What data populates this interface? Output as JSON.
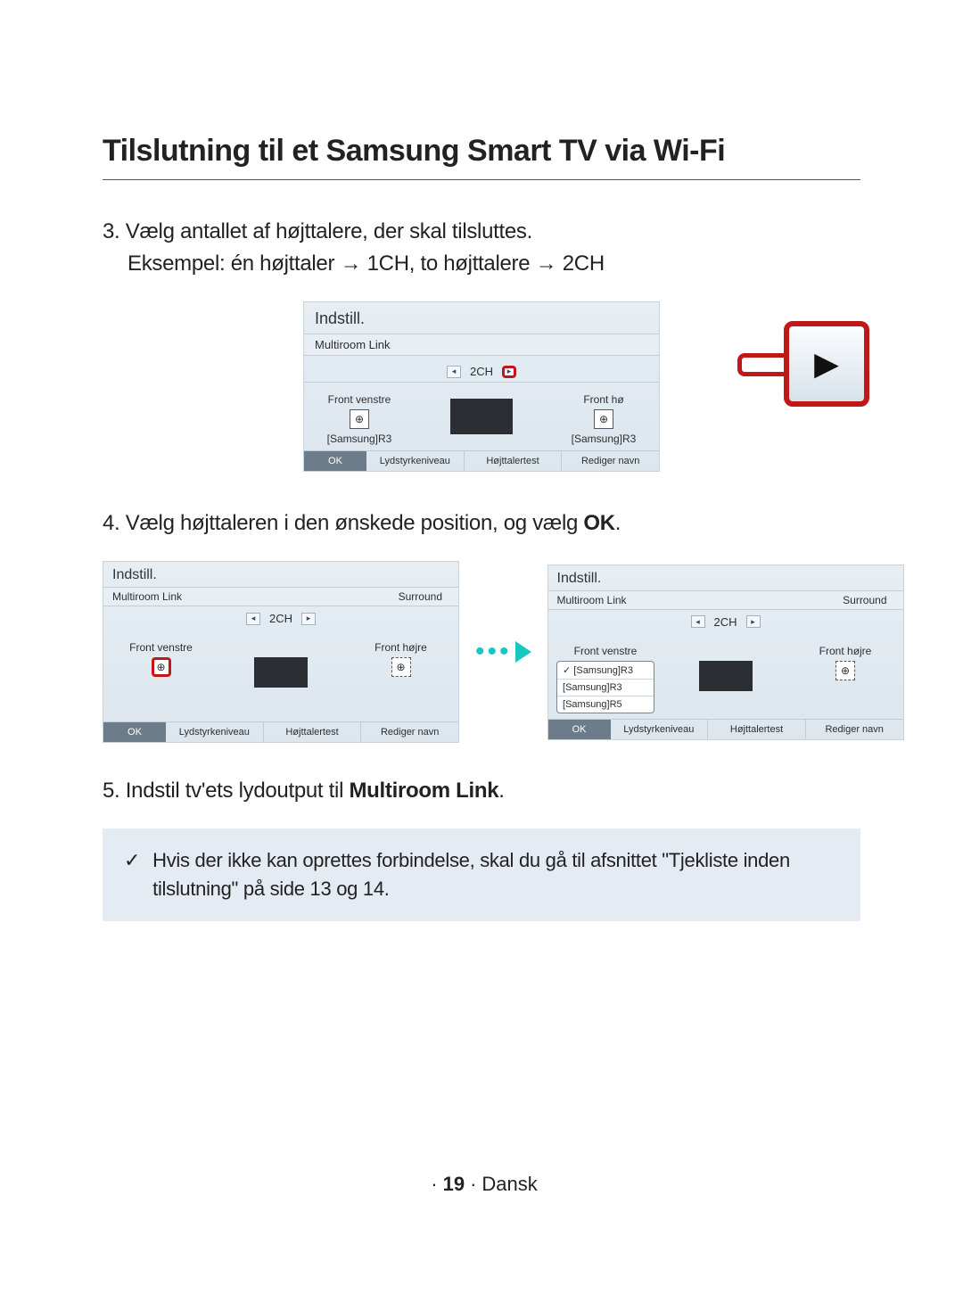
{
  "heading": "Tilslutning til et Samsung Smart TV via Wi-Fi",
  "step3": {
    "num": "3.",
    "line1": "Vælg antallet af højttalere, der skal tilsluttes.",
    "line2_a": "Eksempel: én højttaler ",
    "arrow": "→",
    "line2_b": " 1CH, to højttalere ",
    "line2_c": " 2CH"
  },
  "step4": {
    "num": "4.",
    "text_a": "Vælg højttaleren i den ønskede position, og vælg ",
    "bold": "OK",
    "text_b": "."
  },
  "step5": {
    "num": "5.",
    "text_a": "Indstil tv'ets lydoutput til ",
    "bold": "Multiroom Link",
    "text_b": "."
  },
  "note": {
    "check": "✓",
    "text": "Hvis der ikke kan oprettes forbindelse, skal du gå til afsnittet \"Tjekliste inden tilslutning\" på side 13 og 14."
  },
  "dialog_labels": {
    "title": "Indstill.",
    "multiroom": "Multiroom Link",
    "surround": "Surround",
    "ch": "2CH",
    "front_left": "Front venstre",
    "front_right": "Front højre",
    "front_right_cut": "Front hø",
    "speaker_name": "[Samsung]R3",
    "ok": "OK",
    "vol": "Lydstyrkeniveau",
    "test": "Højttalertest",
    "rename": "Rediger navn",
    "dropdown": [
      "[Samsung]R3",
      "[Samsung]R3",
      "[Samsung]R5"
    ]
  },
  "footer": {
    "page": "19",
    "lang": "Dansk"
  },
  "icons": {
    "play": "▶",
    "left": "◂",
    "right": "▸",
    "target": "⊕",
    "dots": "•••",
    "check": "✓"
  }
}
